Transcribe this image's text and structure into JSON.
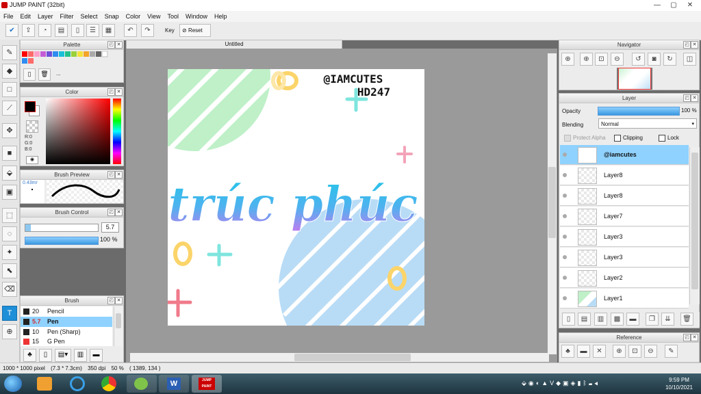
{
  "window": {
    "title": "JUMP PAINT (32bit)",
    "controls": [
      "—",
      "▢",
      "✕"
    ]
  },
  "menu": [
    "File",
    "Edit",
    "Layer",
    "Filter",
    "Select",
    "Snap",
    "Color",
    "View",
    "Tool",
    "Window",
    "Help"
  ],
  "toolbar": {
    "key_label": "Key",
    "reset_label": "Reset"
  },
  "panels": {
    "palette": {
      "title": "Palette",
      "more": "..."
    },
    "color": {
      "title": "Color",
      "r": "R:0",
      "g": "G:0",
      "b": "B:0"
    },
    "brush_preview": {
      "title": "Brush Preview",
      "size": "0.43mr"
    },
    "brush_control": {
      "title": "Brush Control",
      "size": "5.7",
      "opacity": "100 %"
    },
    "brush": {
      "title": "Brush",
      "items": [
        {
          "size": "20",
          "name": "Pencil",
          "active": false
        },
        {
          "size": "5.7",
          "name": "Pen",
          "active": true
        },
        {
          "size": "10",
          "name": "Pen (Sharp)",
          "active": false
        },
        {
          "size": "15",
          "name": "G Pen",
          "active": false
        }
      ]
    },
    "navigator": {
      "title": "Navigator"
    },
    "layer": {
      "title": "Layer",
      "opacity_label": "Opacity",
      "opacity_value": "100 %",
      "blending_label": "Blending",
      "blending_value": "Normal",
      "protect_alpha": "Protect Alpha",
      "clipping": "Clipping",
      "lock": "Lock",
      "layers": [
        "@iamcutes",
        "Layer8",
        "Layer8",
        "Layer7",
        "Layer3",
        "Layer3",
        "Layer2",
        "Layer1"
      ]
    },
    "reference": {
      "title": "Reference"
    }
  },
  "document": {
    "tab": "Untitled",
    "artwork": {
      "watermark_line1": "@IAMCUTES",
      "watermark_line2": "HD247",
      "script_text": "trúc phúc"
    }
  },
  "status": {
    "size": "1000 * 1000 pixel",
    "dims": "(7.3 * 7.3cm)",
    "dpi": "350 dpi",
    "zoom": "50 %",
    "coords": "( 1389, 134 )"
  },
  "taskbar": {
    "time": "9:59 PM",
    "date": "10/10/2021",
    "paint_label": "JUMP PAINT"
  }
}
